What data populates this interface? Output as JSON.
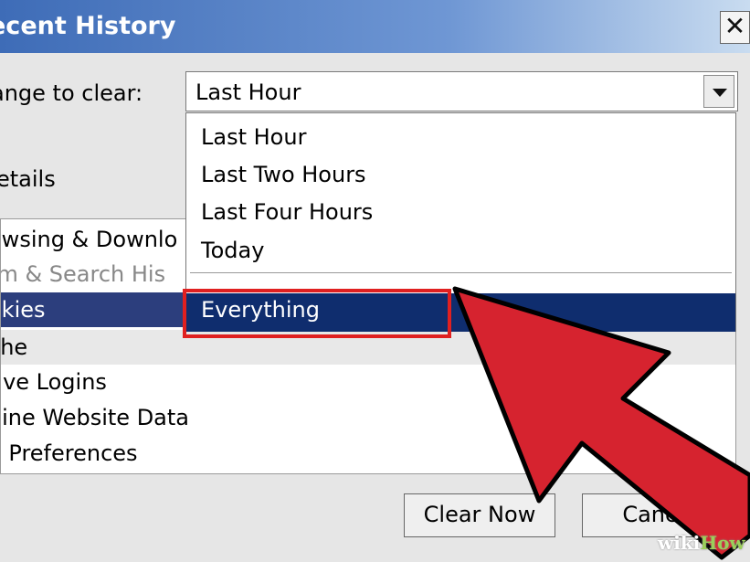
{
  "window": {
    "title": "ecent History",
    "close_glyph": "✕"
  },
  "range": {
    "label": "ange to clear:",
    "selected": "Last Hour",
    "options": [
      "Last Hour",
      "Last Two Hours",
      "Last Four Hours",
      "Today",
      "Everything"
    ]
  },
  "details": {
    "label": "etails"
  },
  "history_items": [
    "owsing & Downlo",
    "rm & Search His",
    "okies",
    "che",
    "tive Logins",
    "fline Website Data",
    "e Preferences"
  ],
  "buttons": {
    "clear_now": "Clear Now",
    "cancel": "Cancel"
  },
  "watermark": {
    "part1": "wiki",
    "part2": "How"
  },
  "colors": {
    "highlight": "#e02020",
    "arrow": "#d6232f",
    "selection": "#0f2d6e"
  }
}
